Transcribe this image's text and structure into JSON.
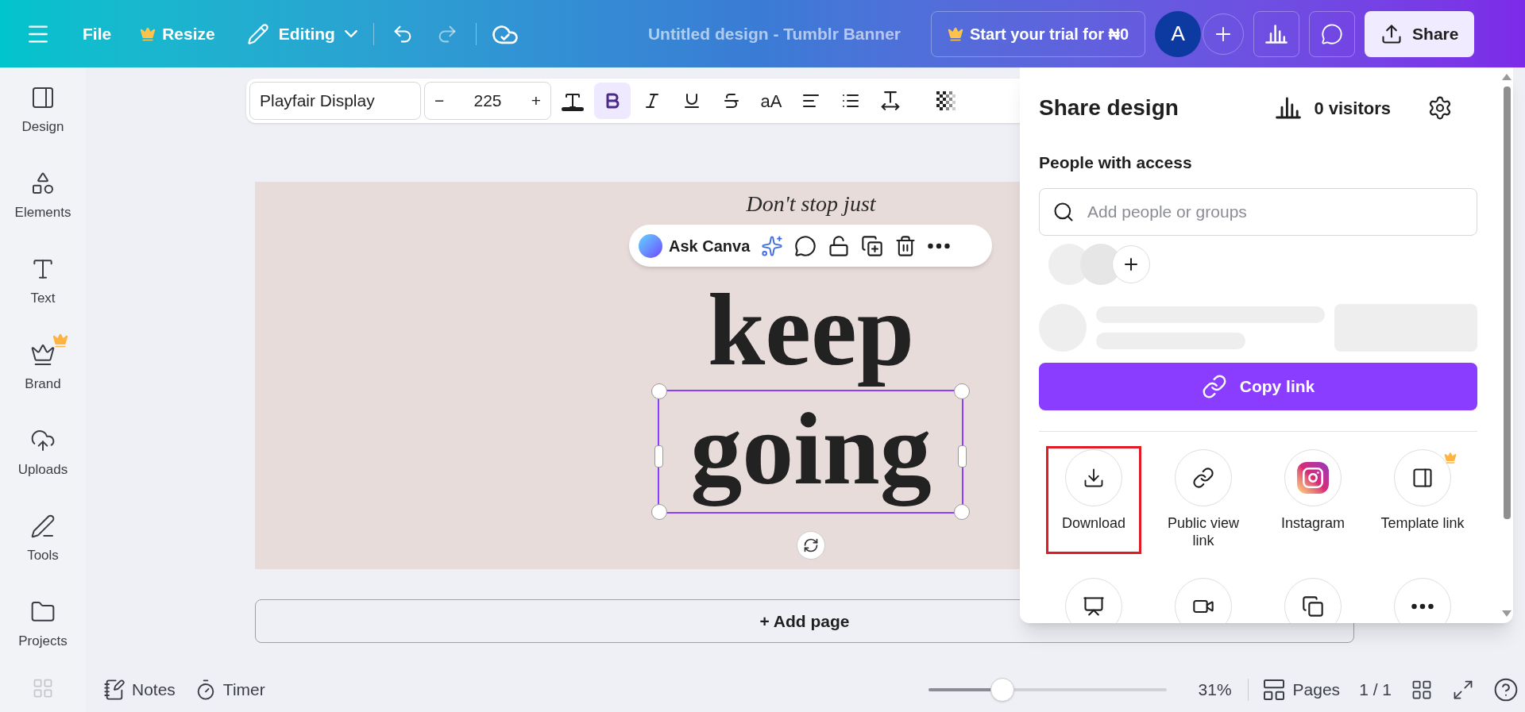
{
  "topbar": {
    "menu": "File",
    "resize": "Resize",
    "mode": "Editing",
    "title": "Untitled design - Tumblr Banner",
    "trial": "Start your trial for ₦0",
    "avatar": "A",
    "share": "Share"
  },
  "text_toolbar": {
    "font": "Playfair Display",
    "size": "225",
    "minus": "−",
    "plus": "+",
    "tools": [
      {
        "kind": "color",
        "selected": false
      },
      {
        "kind": "bold",
        "selected": true
      },
      {
        "kind": "italic",
        "selected": false
      },
      {
        "kind": "underline",
        "selected": false
      },
      {
        "kind": "strike",
        "selected": false
      },
      {
        "kind": "case",
        "label": "aA",
        "selected": false
      },
      {
        "kind": "align",
        "selected": false
      },
      {
        "kind": "list",
        "selected": false
      },
      {
        "kind": "spacing",
        "selected": false
      },
      {
        "kind": "transparency",
        "selected": false
      }
    ]
  },
  "sidebar": {
    "items": [
      {
        "kind": "design",
        "label": "Design",
        "premium": false
      },
      {
        "kind": "elements",
        "label": "Elements",
        "premium": false
      },
      {
        "kind": "text",
        "label": "Text",
        "premium": false
      },
      {
        "kind": "brand",
        "label": "Brand",
        "premium": true
      },
      {
        "kind": "uploads",
        "label": "Uploads",
        "premium": false
      },
      {
        "kind": "tools",
        "label": "Tools",
        "premium": false
      },
      {
        "kind": "projects",
        "label": "Projects",
        "premium": false
      }
    ]
  },
  "canvas": {
    "subtitle": "Don't stop just",
    "heading": [
      "keep",
      "going"
    ],
    "element_toolbar": {
      "ask": "Ask Canva"
    }
  },
  "add_page": "+ Add page",
  "share_panel": {
    "title": "Share design",
    "visitors": "0 visitors",
    "section": "People with access",
    "search": {
      "placeholder": "Add people or groups"
    },
    "copy_link": "Copy link",
    "options": [
      {
        "kind": "download",
        "label": "Download",
        "highlighted": true,
        "premium": false
      },
      {
        "kind": "link",
        "label": "Public view link",
        "highlighted": false,
        "premium": false
      },
      {
        "kind": "instagram",
        "label": "Instagram",
        "highlighted": false,
        "premium": false
      },
      {
        "kind": "template",
        "label": "Template link",
        "highlighted": false,
        "premium": true
      },
      {
        "kind": "present",
        "highlighted": false,
        "premium": false
      },
      {
        "kind": "video",
        "highlighted": false,
        "premium": false
      },
      {
        "kind": "copy",
        "highlighted": false,
        "premium": false
      },
      {
        "kind": "more",
        "highlighted": false,
        "premium": false
      }
    ]
  },
  "bottom_bar": {
    "notes": "Notes",
    "timer": "Timer",
    "zoom": {
      "level": 0.31,
      "reading": "31%"
    },
    "pages": "Pages",
    "page_count": "1 / 1"
  }
}
